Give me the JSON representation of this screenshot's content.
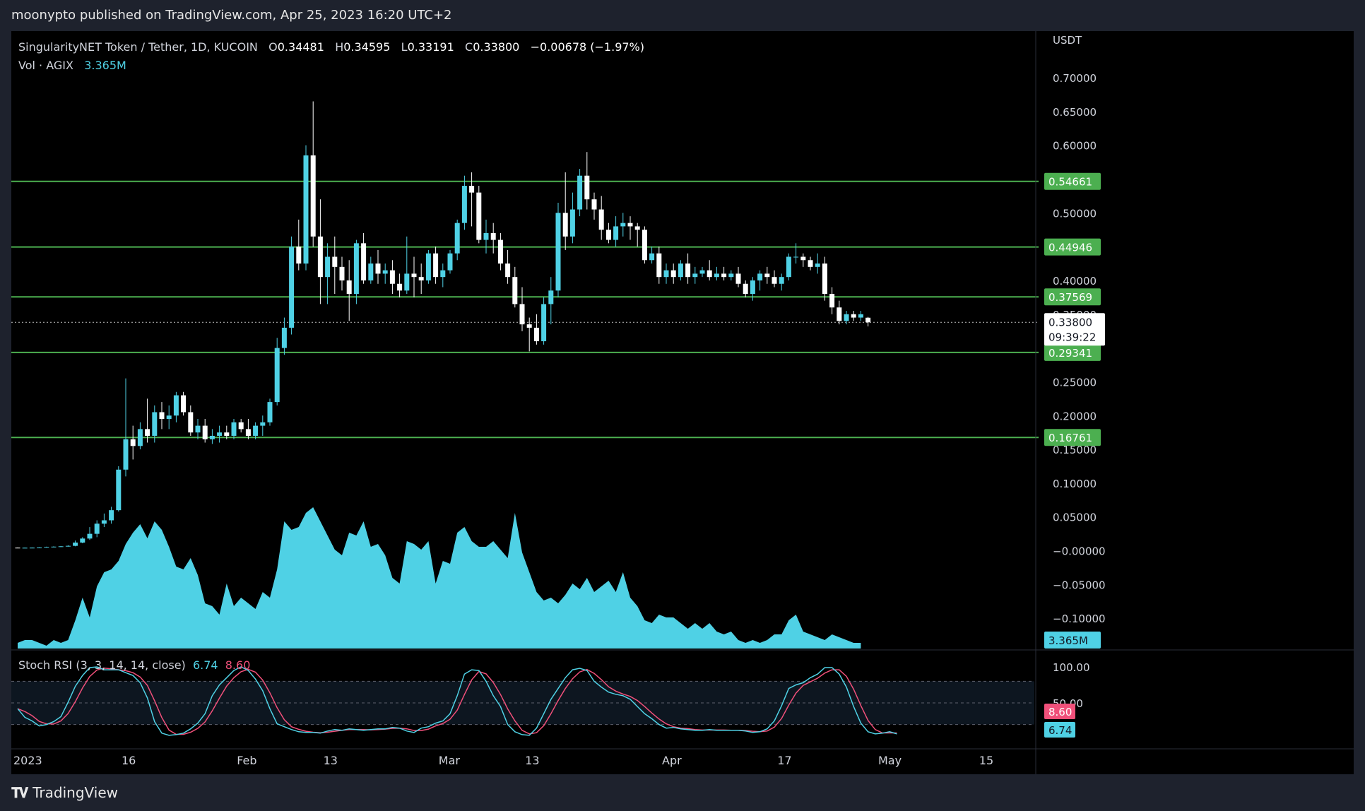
{
  "header": {
    "publisher_text": "moonypto published on TradingView.com, Apr 25, 2023 16:20 UTC+2"
  },
  "legend": {
    "symbol": "SingularityNET Token / Tether, 1D, KUCOIN",
    "o_label": "O",
    "o": "0.34481",
    "h_label": "H",
    "h": "0.34595",
    "l_label": "L",
    "l": "0.33191",
    "c_label": "C",
    "c": "0.33800",
    "change": "−0.00678 (−1.97%)",
    "vol_label": "Vol · AGIX",
    "vol_value": "3.365M"
  },
  "price_axis": {
    "currency": "USDT",
    "ticks": [
      "0.70000",
      "0.65000",
      "0.60000",
      "0.55000",
      "0.50000",
      "0.45000",
      "0.40000",
      "0.35000",
      "0.30000",
      "0.25000",
      "0.20000",
      "0.15000",
      "0.10000",
      "0.05000",
      "−0.00000",
      "−0.05000",
      "−0.10000"
    ]
  },
  "levels": [
    {
      "price": 0.54661,
      "label": "0.54661"
    },
    {
      "price": 0.44946,
      "label": "0.44946"
    },
    {
      "price": 0.37569,
      "label": "0.37569"
    },
    {
      "price": 0.29341,
      "label": "0.29341"
    },
    {
      "price": 0.16761,
      "label": "0.16761"
    }
  ],
  "current_price": {
    "label": "0.33800",
    "countdown": "09:39:22",
    "price": 0.338
  },
  "volume_badge": "3.365M",
  "stoch": {
    "legend": "Stoch RSI (3, 3, 14, 14, close)",
    "k_value": "6.74",
    "d_value": "8.60",
    "ticks": [
      "100.00",
      "50.00"
    ],
    "k_color": "#4fd1e5",
    "d_color": "#f0507a"
  },
  "time_axis": {
    "labels": [
      {
        "text": "2023",
        "index": 0
      },
      {
        "text": "16",
        "index": 15
      },
      {
        "text": "Feb",
        "index": 31
      },
      {
        "text": "13",
        "index": 43
      },
      {
        "text": "Mar",
        "index": 59
      },
      {
        "text": "13",
        "index": 71
      },
      {
        "text": "Apr",
        "index": 90
      },
      {
        "text": "17",
        "index": 106
      },
      {
        "text": "May",
        "index": 120
      },
      {
        "text": "15",
        "index": 134
      }
    ]
  },
  "colors": {
    "up": "#4fd1e5",
    "down": "#ffffff",
    "level": "#4caf50",
    "volume": "#4fd1e5"
  },
  "footer": {
    "brand": "TradingView"
  },
  "chart_data": {
    "type": "candlestick",
    "title": "SingularityNET Token / Tether, 1D, KUCOIN",
    "xlabel": "",
    "ylabel": "USDT",
    "x_start_date": "2023-01-01",
    "ylim": [
      -0.12,
      0.7
    ],
    "grid": false,
    "ohlc": [
      [
        0.0045,
        0.0046,
        0.0041,
        0.0043
      ],
      [
        0.0043,
        0.0045,
        0.004,
        0.0044
      ],
      [
        0.0044,
        0.0046,
        0.0041,
        0.0045
      ],
      [
        0.0045,
        0.005,
        0.0042,
        0.0047
      ],
      [
        0.0047,
        0.006,
        0.0045,
        0.0057
      ],
      [
        0.0057,
        0.0065,
        0.005,
        0.006
      ],
      [
        0.006,
        0.007,
        0.0055,
        0.0065
      ],
      [
        0.0065,
        0.008,
        0.006,
        0.0072
      ],
      [
        0.0072,
        0.015,
        0.0065,
        0.012
      ],
      [
        0.012,
        0.02,
        0.011,
        0.018
      ],
      [
        0.018,
        0.035,
        0.016,
        0.025
      ],
      [
        0.025,
        0.045,
        0.02,
        0.04
      ],
      [
        0.04,
        0.055,
        0.035,
        0.045
      ],
      [
        0.045,
        0.065,
        0.04,
        0.06
      ],
      [
        0.06,
        0.125,
        0.058,
        0.12
      ],
      [
        0.12,
        0.255,
        0.11,
        0.165
      ],
      [
        0.165,
        0.185,
        0.135,
        0.155
      ],
      [
        0.155,
        0.19,
        0.15,
        0.18
      ],
      [
        0.18,
        0.225,
        0.16,
        0.17
      ],
      [
        0.17,
        0.215,
        0.16,
        0.205
      ],
      [
        0.205,
        0.22,
        0.18,
        0.195
      ],
      [
        0.195,
        0.215,
        0.18,
        0.2
      ],
      [
        0.2,
        0.235,
        0.19,
        0.23
      ],
      [
        0.23,
        0.235,
        0.2,
        0.205
      ],
      [
        0.205,
        0.215,
        0.17,
        0.175
      ],
      [
        0.175,
        0.195,
        0.165,
        0.185
      ],
      [
        0.185,
        0.195,
        0.16,
        0.165
      ],
      [
        0.165,
        0.18,
        0.158,
        0.17
      ],
      [
        0.17,
        0.185,
        0.16,
        0.175
      ],
      [
        0.175,
        0.185,
        0.165,
        0.17
      ],
      [
        0.17,
        0.195,
        0.165,
        0.19
      ],
      [
        0.19,
        0.195,
        0.175,
        0.18
      ],
      [
        0.18,
        0.195,
        0.165,
        0.17
      ],
      [
        0.17,
        0.19,
        0.165,
        0.185
      ],
      [
        0.185,
        0.2,
        0.17,
        0.19
      ],
      [
        0.19,
        0.225,
        0.185,
        0.22
      ],
      [
        0.22,
        0.315,
        0.215,
        0.3
      ],
      [
        0.3,
        0.345,
        0.29,
        0.33
      ],
      [
        0.33,
        0.465,
        0.32,
        0.45
      ],
      [
        0.45,
        0.49,
        0.415,
        0.425
      ],
      [
        0.425,
        0.6,
        0.415,
        0.585
      ],
      [
        0.585,
        0.665,
        0.45,
        0.465
      ],
      [
        0.465,
        0.52,
        0.365,
        0.405
      ],
      [
        0.405,
        0.455,
        0.365,
        0.435
      ],
      [
        0.435,
        0.465,
        0.38,
        0.42
      ],
      [
        0.42,
        0.435,
        0.385,
        0.4
      ],
      [
        0.4,
        0.43,
        0.34,
        0.38
      ],
      [
        0.38,
        0.46,
        0.365,
        0.455
      ],
      [
        0.455,
        0.47,
        0.395,
        0.4
      ],
      [
        0.4,
        0.435,
        0.395,
        0.425
      ],
      [
        0.425,
        0.445,
        0.395,
        0.41
      ],
      [
        0.41,
        0.425,
        0.395,
        0.415
      ],
      [
        0.415,
        0.43,
        0.38,
        0.395
      ],
      [
        0.395,
        0.41,
        0.375,
        0.385
      ],
      [
        0.385,
        0.465,
        0.38,
        0.41
      ],
      [
        0.41,
        0.435,
        0.375,
        0.405
      ],
      [
        0.405,
        0.425,
        0.38,
        0.4
      ],
      [
        0.4,
        0.445,
        0.395,
        0.44
      ],
      [
        0.44,
        0.45,
        0.395,
        0.405
      ],
      [
        0.405,
        0.425,
        0.39,
        0.415
      ],
      [
        0.415,
        0.445,
        0.41,
        0.44
      ],
      [
        0.44,
        0.49,
        0.43,
        0.485
      ],
      [
        0.485,
        0.555,
        0.475,
        0.54
      ],
      [
        0.54,
        0.56,
        0.48,
        0.53
      ],
      [
        0.53,
        0.54,
        0.455,
        0.46
      ],
      [
        0.46,
        0.49,
        0.44,
        0.47
      ],
      [
        0.47,
        0.485,
        0.44,
        0.46
      ],
      [
        0.46,
        0.47,
        0.415,
        0.425
      ],
      [
        0.425,
        0.445,
        0.395,
        0.405
      ],
      [
        0.405,
        0.42,
        0.36,
        0.365
      ],
      [
        0.365,
        0.39,
        0.325,
        0.335
      ],
      [
        0.335,
        0.345,
        0.295,
        0.33
      ],
      [
        0.33,
        0.35,
        0.305,
        0.31
      ],
      [
        0.31,
        0.375,
        0.305,
        0.365
      ],
      [
        0.365,
        0.405,
        0.335,
        0.385
      ],
      [
        0.385,
        0.515,
        0.375,
        0.5
      ],
      [
        0.5,
        0.56,
        0.445,
        0.465
      ],
      [
        0.465,
        0.53,
        0.455,
        0.505
      ],
      [
        0.505,
        0.565,
        0.495,
        0.555
      ],
      [
        0.555,
        0.59,
        0.505,
        0.52
      ],
      [
        0.52,
        0.53,
        0.49,
        0.505
      ],
      [
        0.505,
        0.525,
        0.46,
        0.475
      ],
      [
        0.475,
        0.485,
        0.455,
        0.46
      ],
      [
        0.46,
        0.495,
        0.45,
        0.48
      ],
      [
        0.48,
        0.5,
        0.465,
        0.485
      ],
      [
        0.485,
        0.495,
        0.46,
        0.48
      ],
      [
        0.48,
        0.485,
        0.45,
        0.475
      ],
      [
        0.475,
        0.48,
        0.425,
        0.43
      ],
      [
        0.43,
        0.45,
        0.425,
        0.44
      ],
      [
        0.44,
        0.45,
        0.395,
        0.405
      ],
      [
        0.405,
        0.425,
        0.395,
        0.415
      ],
      [
        0.415,
        0.425,
        0.395,
        0.405
      ],
      [
        0.405,
        0.43,
        0.4,
        0.425
      ],
      [
        0.425,
        0.44,
        0.395,
        0.405
      ],
      [
        0.405,
        0.42,
        0.395,
        0.41
      ],
      [
        0.41,
        0.42,
        0.405,
        0.415
      ],
      [
        0.415,
        0.43,
        0.4,
        0.405
      ],
      [
        0.405,
        0.42,
        0.4,
        0.41
      ],
      [
        0.41,
        0.42,
        0.4,
        0.405
      ],
      [
        0.405,
        0.415,
        0.4,
        0.41
      ],
      [
        0.41,
        0.42,
        0.39,
        0.395
      ],
      [
        0.395,
        0.4,
        0.375,
        0.38
      ],
      [
        0.38,
        0.405,
        0.37,
        0.4
      ],
      [
        0.4,
        0.415,
        0.385,
        0.41
      ],
      [
        0.41,
        0.42,
        0.395,
        0.405
      ],
      [
        0.405,
        0.415,
        0.39,
        0.395
      ],
      [
        0.395,
        0.41,
        0.385,
        0.405
      ],
      [
        0.405,
        0.44,
        0.4,
        0.435
      ],
      [
        0.435,
        0.455,
        0.425,
        0.435
      ],
      [
        0.435,
        0.44,
        0.42,
        0.43
      ],
      [
        0.43,
        0.435,
        0.415,
        0.42
      ],
      [
        0.42,
        0.44,
        0.41,
        0.425
      ],
      [
        0.425,
        0.435,
        0.37,
        0.38
      ],
      [
        0.38,
        0.39,
        0.35,
        0.36
      ],
      [
        0.36,
        0.37,
        0.335,
        0.34
      ],
      [
        0.34,
        0.355,
        0.335,
        0.35
      ],
      [
        0.35,
        0.355,
        0.34,
        0.345
      ],
      [
        0.345,
        0.355,
        0.34,
        0.35
      ],
      [
        0.3448,
        0.346,
        0.3319,
        0.338
      ]
    ],
    "volume": [
      2,
      3,
      3,
      2,
      1,
      3,
      2,
      3,
      10,
      18,
      11,
      22,
      27,
      28,
      31,
      37,
      41,
      44,
      39,
      45,
      42,
      36,
      29,
      28,
      32,
      26,
      16,
      15,
      12,
      23,
      15,
      18,
      16,
      14,
      20,
      18,
      28,
      45,
      42,
      43,
      48,
      50,
      45,
      40,
      35,
      33,
      41,
      40,
      45,
      36,
      37,
      33,
      25,
      23,
      38,
      37,
      35,
      38,
      23,
      31,
      30,
      41,
      43,
      38,
      36,
      36,
      38,
      35,
      32,
      48,
      34,
      27,
      20,
      17,
      18,
      16,
      19,
      23,
      21,
      25,
      20,
      22,
      24,
      20,
      27,
      18,
      15,
      10,
      9,
      12,
      11,
      11,
      9,
      7,
      9,
      7,
      9,
      6,
      5,
      6,
      3,
      2,
      3,
      2,
      3,
      5,
      5,
      10,
      12,
      6,
      5,
      4,
      3,
      5,
      4,
      3,
      2,
      2
    ],
    "volume_units": "M (approx)",
    "stoch_rsi": {
      "k": [
        42,
        30,
        25,
        18,
        20,
        24,
        31,
        51,
        73,
        88,
        99,
        100,
        96,
        96,
        96,
        92,
        88,
        78,
        57,
        24,
        8,
        5,
        6,
        8,
        14,
        22,
        35,
        60,
        75,
        85,
        95,
        100,
        95,
        83,
        67,
        42,
        21,
        17,
        13,
        10,
        9,
        9,
        8,
        11,
        13,
        12,
        14,
        13,
        12,
        13,
        14,
        14,
        16,
        15,
        11,
        9,
        15,
        17,
        22,
        25,
        35,
        60,
        90,
        96,
        95,
        80,
        60,
        45,
        20,
        10,
        6,
        5,
        15,
        35,
        55,
        70,
        85,
        96,
        98,
        95,
        80,
        72,
        65,
        62,
        60,
        55,
        45,
        35,
        28,
        20,
        15,
        16,
        14,
        13,
        12,
        12,
        13,
        12,
        12,
        12,
        12,
        11,
        9,
        10,
        14,
        25,
        46,
        70,
        75,
        78,
        85,
        90,
        99,
        99,
        90,
        72,
        45,
        22,
        10,
        7,
        8,
        10,
        7
      ]
    }
  }
}
